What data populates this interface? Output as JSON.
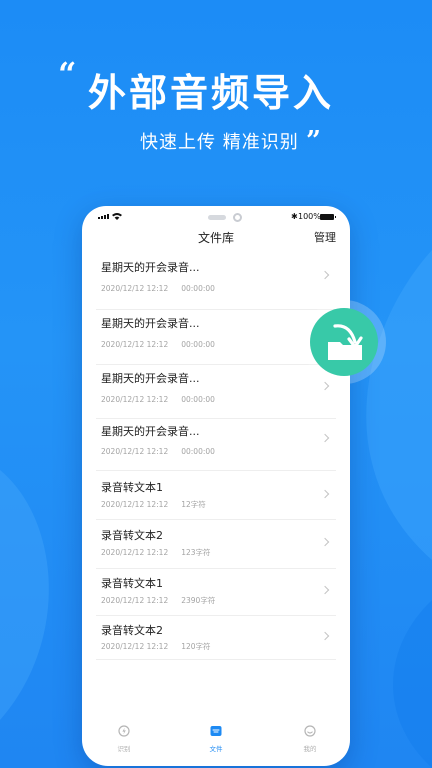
{
  "hero": {
    "open_quote": "“",
    "headline": "外部音频导入",
    "subline": "快速上传 精准识别",
    "close_quote": "”"
  },
  "status_bar": {
    "bluetooth": "✱",
    "battery": "100%"
  },
  "screen": {
    "title": "文件库",
    "action": "管理"
  },
  "files": [
    {
      "name": "星期天的开会录音...",
      "date": "2020/12/12 12:12",
      "info": "00:00:00"
    },
    {
      "name": "星期天的开会录音...",
      "date": "2020/12/12 12:12",
      "info": "00:00:00"
    },
    {
      "name": "星期天的开会录音...",
      "date": "2020/12/12 12:12",
      "info": "00:00:00"
    },
    {
      "name": "星期天的开会录音...",
      "date": "2020/12/12 12:12",
      "info": "00:00:00"
    },
    {
      "name": "录音转文本1",
      "date": "2020/12/12 12:12",
      "info": "12字符"
    },
    {
      "name": "录音转文本2",
      "date": "2020/12/12 12:12",
      "info": "123字符"
    },
    {
      "name": "录音转文本1",
      "date": "2020/12/12 12:12",
      "info": "2390字符"
    },
    {
      "name": "录音转文本2",
      "date": "2020/12/12 12:12",
      "info": "120字符"
    }
  ],
  "tabs": [
    {
      "label": "识别",
      "icon": "recognize-icon",
      "active": false
    },
    {
      "label": "文件",
      "icon": "folder-icon",
      "active": true
    },
    {
      "label": "我的",
      "icon": "profile-icon",
      "active": false
    }
  ],
  "colors": {
    "background": "#1c8cf6",
    "accent": "#1d8af3",
    "import_button": "#38c9a8"
  },
  "import_button": {
    "icon": "folder-import-icon"
  }
}
